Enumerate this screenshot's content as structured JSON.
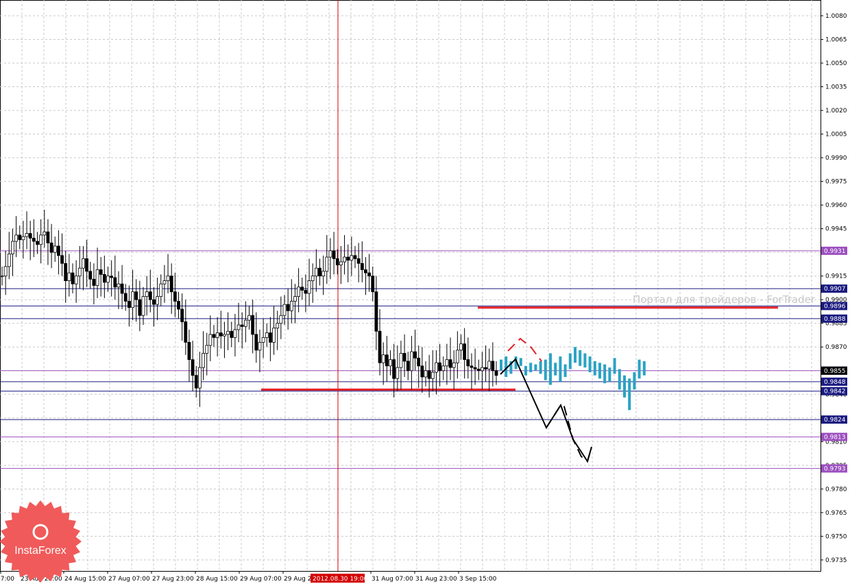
{
  "chart_data": {
    "type": "candlestick",
    "instrument_prices_note": "",
    "y_axis": {
      "ticks": [
        "1.0080",
        "1.0065",
        "1.0050",
        "1.0035",
        "1.0020",
        "1.0005",
        "0.9990",
        "0.9975",
        "0.9960",
        "0.9945",
        "0.9930",
        "0.9915",
        "0.9900",
        "0.9885",
        "0.9870",
        "0.9855",
        "0.9840",
        "0.9825",
        "0.9810",
        "0.9795",
        "0.9780",
        "0.9765",
        "0.9750",
        "0.9735"
      ],
      "range": [
        0.9728,
        1.009
      ]
    },
    "x_axis": {
      "ticks": [
        "07:00",
        "23 Aug 23:00",
        "24 Aug 15:00",
        "27 Aug 07:00",
        "27 Aug 23:00",
        "28 Aug 15:00",
        "29 Aug 07:00",
        "29 Aug 23:00",
        "31 Aug 07:00",
        "31 Aug 23:00",
        "3 Sep 15:00"
      ],
      "crosshair_label": "2012.08.30 19:00"
    },
    "grid": true,
    "levels": [
      {
        "price": 0.9931,
        "label": "0.9931",
        "color": "#9c4fbf"
      },
      {
        "price": 0.9907,
        "label": "0.9907",
        "color": "#1a1a80"
      },
      {
        "price": 0.9896,
        "label": "0.9896",
        "color": "#1a1a80"
      },
      {
        "price": 0.9888,
        "label": "0.9888",
        "color": "#1a1a80"
      },
      {
        "price": 0.9855,
        "label": "0.9855",
        "color": "#9c4fbf"
      },
      {
        "price": 0.9848,
        "label": "0.9848",
        "color": "#1a1a80"
      },
      {
        "price": 0.9842,
        "label": "0.9842",
        "color": "#1a1a80"
      },
      {
        "price": 0.9824,
        "label": "0.9824",
        "color": "#1a1a80"
      },
      {
        "price": 0.9813,
        "label": "0.9813",
        "color": "#9c4fbf"
      },
      {
        "price": 0.9793,
        "label": "0.9793",
        "color": "#9c4fbf"
      }
    ],
    "current_price": {
      "price": 0.9855,
      "label": "0.9855"
    },
    "support_resistance": [
      {
        "price": 0.9895,
        "color": "#e31e24"
      },
      {
        "price": 0.9843,
        "color": "#e31e24"
      }
    ],
    "candles": [
      0.9915,
      0.9921,
      0.9929,
      0.9937,
      0.9941,
      0.9938,
      0.994,
      0.9942,
      0.9939,
      0.9937,
      0.9935,
      0.9941,
      0.9943,
      0.9936,
      0.993,
      0.9934,
      0.9928,
      0.9923,
      0.9912,
      0.9917,
      0.991,
      0.9915,
      0.992,
      0.9926,
      0.9918,
      0.9913,
      0.9909,
      0.9919,
      0.9916,
      0.9911,
      0.9915,
      0.9914,
      0.9908,
      0.991,
      0.9904,
      0.9899,
      0.9895,
      0.9905,
      0.99,
      0.989,
      0.9902,
      0.9905,
      0.99,
      0.9897,
      0.9902,
      0.991,
      0.9912,
      0.9915,
      0.9905,
      0.9899,
      0.9894,
      0.9886,
      0.9873,
      0.9862,
      0.9852,
      0.9844,
      0.9857,
      0.9866,
      0.9871,
      0.9878,
      0.9876,
      0.9879,
      0.9877,
      0.9878,
      0.988,
      0.9876,
      0.9881,
      0.9884,
      0.9883,
      0.9887,
      0.989,
      0.9878,
      0.9868,
      0.9873,
      0.9876,
      0.9879,
      0.9873,
      0.9882,
      0.9885,
      0.989,
      0.9897,
      0.9893,
      0.9899,
      0.9902,
      0.9908,
      0.9906,
      0.9904,
      0.9912,
      0.9915,
      0.992,
      0.9915,
      0.9918,
      0.9927,
      0.9931,
      0.9926,
      0.9922,
      0.9924,
      0.9927,
      0.9925,
      0.9928,
      0.9926,
      0.9923,
      0.9919,
      0.9917,
      0.9915,
      0.9905,
      0.988,
      0.986,
      0.9865,
      0.9858,
      0.9862,
      0.985,
      0.9857,
      0.9866,
      0.9861,
      0.9855,
      0.9867,
      0.9863,
      0.9858,
      0.9851,
      0.9855,
      0.985,
      0.9854,
      0.986,
      0.9855,
      0.9858,
      0.9862,
      0.9857,
      0.986,
      0.9868,
      0.9872,
      0.9862,
      0.9858,
      0.9857,
      0.9856,
      0.9855,
      0.9857,
      0.9856,
      0.9861,
      0.9855,
      0.9852
    ],
    "forecast_bars": [
      [
        0.9855,
        0.9862
      ],
      [
        0.9851,
        0.9864
      ],
      [
        0.9853,
        0.9861
      ],
      [
        0.9856,
        0.9864
      ],
      [
        0.9858,
        0.9863
      ],
      [
        0.9852,
        0.9858
      ],
      [
        0.9854,
        0.986
      ],
      [
        0.9855,
        0.9859
      ],
      [
        0.9853,
        0.9861
      ],
      [
        0.9849,
        0.9862
      ],
      [
        0.9846,
        0.9866
      ],
      [
        0.9852,
        0.986
      ],
      [
        0.9848,
        0.9864
      ],
      [
        0.9851,
        0.9859
      ],
      [
        0.9856,
        0.9866
      ],
      [
        0.986,
        0.987
      ],
      [
        0.9858,
        0.9868
      ],
      [
        0.9857,
        0.9866
      ],
      [
        0.9854,
        0.9864
      ],
      [
        0.9852,
        0.9861
      ],
      [
        0.985,
        0.986
      ],
      [
        0.9847,
        0.9859
      ],
      [
        0.9848,
        0.9857
      ],
      [
        0.9853,
        0.9863
      ],
      [
        0.9843,
        0.9856
      ],
      [
        0.9838,
        0.9852
      ],
      [
        0.983,
        0.985
      ],
      [
        0.9843,
        0.9854
      ],
      [
        0.985,
        0.9862
      ],
      [
        0.9852,
        0.9861
      ]
    ]
  },
  "watermark": "Портал для трейдеров - ForTrader",
  "logo_text": "InstaForex",
  "colors": {
    "grid": "#c8c8c8",
    "candle": "#000000",
    "forecast": "#2aa3c4",
    "red_lines": "#e31e24",
    "crosshair": "#d40000",
    "price_label_bg": "#1a1a80",
    "logo_bg": "#f05a5a"
  }
}
